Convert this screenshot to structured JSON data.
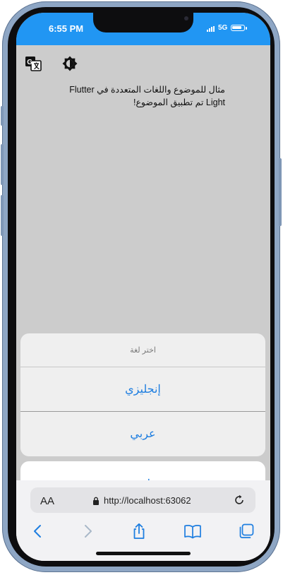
{
  "status": {
    "time": "6:55 PM",
    "network": "5G",
    "battery_level": 0.85
  },
  "app": {
    "message_line1": "مثال للموضوع واللغات المتعددة في Flutter",
    "message_line2": "Light تم تطبيق الموضوع!"
  },
  "sheet": {
    "title": "اختر لغة",
    "actions": [
      "إنجليزي",
      "عربي"
    ],
    "cancel_label": "يلغي"
  },
  "browser": {
    "text_size_label": "AA",
    "url": "http://localhost:63062"
  },
  "icons": {
    "translate": "g-translate-icon",
    "theme": "brightness-icon",
    "lock": "lock-icon",
    "reload": "reload-icon",
    "back": "chevron-left-icon",
    "forward": "chevron-right-icon",
    "share": "share-icon",
    "bookmarks": "book-icon",
    "tabs": "tabs-icon"
  },
  "colors": {
    "status_bar": "#2196f3",
    "app_background": "#cccccc",
    "action_text": "#1e7ee0",
    "browser_icons": "#1e7ee0"
  }
}
